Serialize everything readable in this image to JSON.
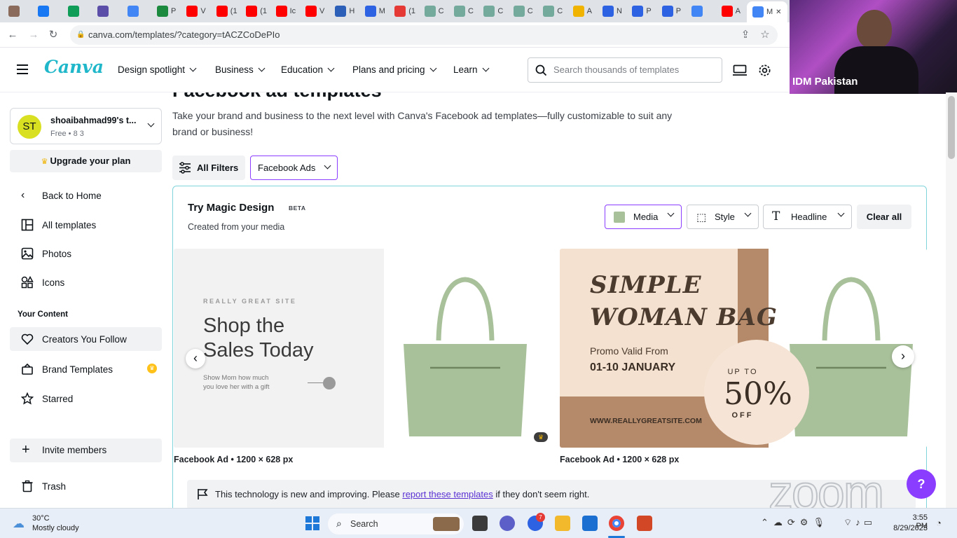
{
  "browser": {
    "tabs": [
      {
        "label": "",
        "color": "#8b6b5c"
      },
      {
        "label": "",
        "color": "#1877f2"
      },
      {
        "label": "",
        "color": "#0f9d58"
      },
      {
        "label": "",
        "color": "#5b4ea8"
      },
      {
        "label": "",
        "color": "#4285f4"
      },
      {
        "label": "P",
        "color": "#1b8a3e"
      },
      {
        "label": "V",
        "color": "#ff0000"
      },
      {
        "label": "(1",
        "color": "#ff0000"
      },
      {
        "label": "(1",
        "color": "#ff0000"
      },
      {
        "label": "Ic",
        "color": "#ff0000"
      },
      {
        "label": "V",
        "color": "#ff0000"
      },
      {
        "label": "H",
        "color": "#2b5fb8"
      },
      {
        "label": "M",
        "color": "#2d63e2"
      },
      {
        "label": "(1",
        "color": "#e53935"
      },
      {
        "label": "C",
        "color": "#74aa9c"
      },
      {
        "label": "C",
        "color": "#74aa9c"
      },
      {
        "label": "C",
        "color": "#74aa9c"
      },
      {
        "label": "C",
        "color": "#74aa9c"
      },
      {
        "label": "C",
        "color": "#74aa9c"
      },
      {
        "label": "A",
        "color": "#f0b400"
      },
      {
        "label": "N",
        "color": "#2d63e2"
      },
      {
        "label": "P",
        "color": "#2d63e2"
      },
      {
        "label": "P",
        "color": "#2d63e2"
      },
      {
        "label": "",
        "color": "#4285f4"
      },
      {
        "label": "A",
        "color": "#ff0000"
      },
      {
        "label": "M",
        "color": "#4285f4"
      }
    ],
    "active_tab_close": "✕",
    "url": "canva.com/templates/?category=tACZCoDePIo"
  },
  "header": {
    "logo": "Canva",
    "nav": [
      {
        "label": "Design spotlight"
      },
      {
        "label": "Business"
      },
      {
        "label": "Education"
      },
      {
        "label": "Plans and pricing"
      },
      {
        "label": "Learn"
      }
    ],
    "search_placeholder": "Search thousands of templates"
  },
  "video_overlay": {
    "name": "IDM Pakistan"
  },
  "sidebar": {
    "team": {
      "initials": "ST",
      "name": "shoaibahmad99's t...",
      "meta": "Free • 8 3",
      "avatar_color": "#d9e021"
    },
    "upgrade": "Upgrade your plan",
    "back": "Back to Home",
    "nav": [
      {
        "label": "All templates"
      },
      {
        "label": "Photos"
      },
      {
        "label": "Icons"
      }
    ],
    "your_content_title": "Your Content",
    "content": [
      {
        "label": "Creators You Follow"
      },
      {
        "label": "Brand Templates"
      },
      {
        "label": "Starred"
      }
    ],
    "invite": "Invite members",
    "trash": "Trash"
  },
  "main": {
    "title": "Facebook ad templates",
    "description_line1": "Take your brand and business to the next level with Canva's Facebook ad templates—fully customizable to suit any",
    "description_line2": "brand or business!",
    "all_filters": "All Filters",
    "facebook_ads_filter": "Facebook Ads",
    "magic_design": {
      "title": "Try Magic Design",
      "badge": "BETA",
      "subtitle": "Created from your media",
      "chips": [
        {
          "label": "Media"
        },
        {
          "label": "Style"
        },
        {
          "label": "Headline"
        }
      ],
      "clear_all": "Clear all"
    },
    "cards": [
      {
        "caption": "Facebook Ad • 1200 × 628 px",
        "site": "REALLY GREAT SITE",
        "headline1": "Shop the",
        "headline2": "Sales Today",
        "sub1": "Show Mom how much",
        "sub2": "you love her with a gift"
      },
      {
        "caption": "Facebook Ad • 1200 × 628 px",
        "headline1": "SIMPLE",
        "headline2": "WOMAN BAG",
        "promo": "Promo Valid From",
        "dates": "01-10 JANUARY",
        "upto": "UP TO",
        "percent": "50%",
        "off": "OFF",
        "site": "WWW.REALLYGREATSITE.COM"
      }
    ],
    "notice_text": "This technology is new and improving. Please ",
    "notice_link": "report these templates",
    "notice_tail": " if they don't seem right.",
    "help": "?"
  },
  "zoom_watermark": "zoom",
  "taskbar": {
    "weather_temp": "30°C",
    "weather_desc": "Mostly cloudy",
    "search": "Search",
    "time": "3:55 PM",
    "date": "8/29/2023",
    "badge": "7"
  }
}
